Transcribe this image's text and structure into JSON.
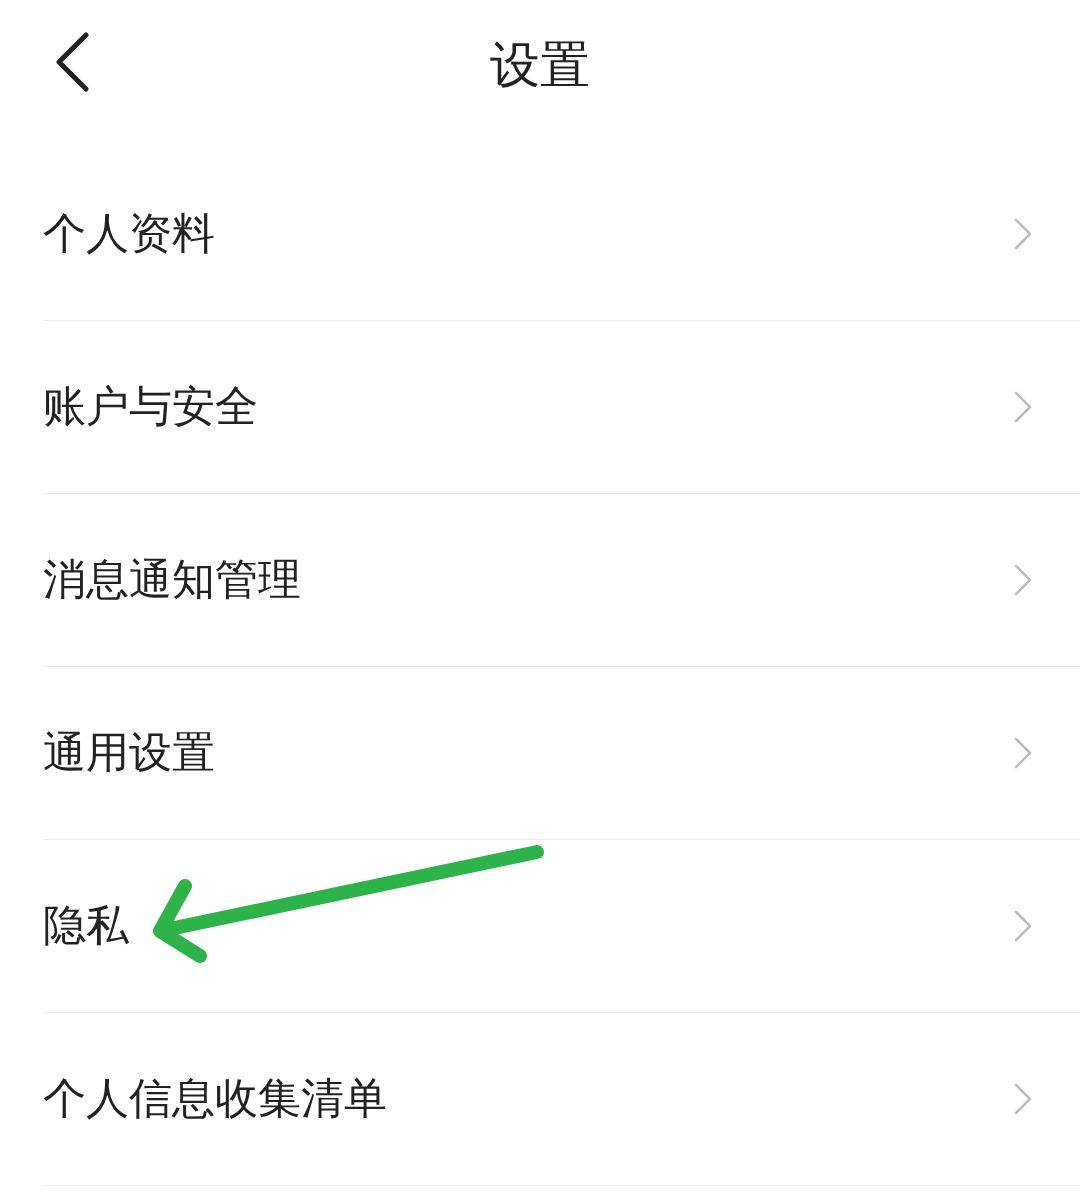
{
  "header": {
    "title": "设置"
  },
  "items": [
    {
      "label": "个人资料",
      "annotated": false
    },
    {
      "label": "账户与安全",
      "annotated": false
    },
    {
      "label": "消息通知管理",
      "annotated": false
    },
    {
      "label": "通用设置",
      "annotated": false
    },
    {
      "label": "隐私",
      "annotated": true
    },
    {
      "label": "个人信息收集清单",
      "annotated": false
    }
  ]
}
